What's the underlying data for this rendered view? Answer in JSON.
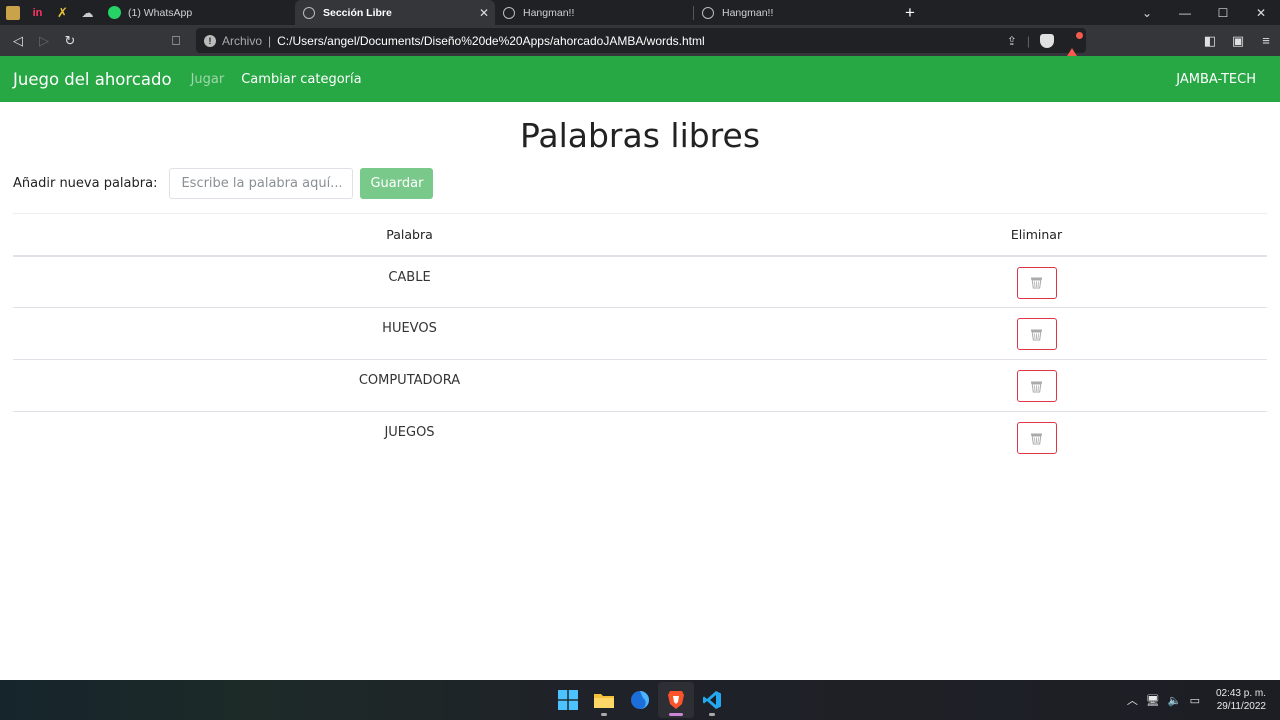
{
  "browser": {
    "tabs": [
      {
        "label": "(1) WhatsApp",
        "active": false
      },
      {
        "label": "Sección Libre",
        "active": true
      },
      {
        "label": "Hangman!!",
        "active": false
      },
      {
        "label": "Hangman!!",
        "active": false
      }
    ],
    "archivo_label": "Archivo",
    "url": "C:/Users/angel/Documents/Diseño%20de%20Apps/ahorcadoJAMBA/words.html",
    "rewards_badge": "1"
  },
  "navbar": {
    "brand": "Juego del ahorcado",
    "links": [
      "Jugar",
      "Cambiar categoría"
    ],
    "right": "JAMBA-TECH"
  },
  "page": {
    "title": "Palabras libres",
    "add_label": "Añadir nueva palabra:",
    "input_placeholder": "Escribe la palabra aquí...",
    "save_label": "Guardar"
  },
  "table": {
    "headers": [
      "Palabra",
      "Eliminar"
    ],
    "rows": [
      "CABLE",
      "HUEVOS",
      "COMPUTADORA",
      "JUEGOS"
    ]
  },
  "taskbar": {
    "time": "02:43 p. m.",
    "date": "29/11/2022"
  },
  "colors": {
    "navbar": "#28a745",
    "save_button": "#79c98a",
    "delete_border": "#dc3545"
  }
}
